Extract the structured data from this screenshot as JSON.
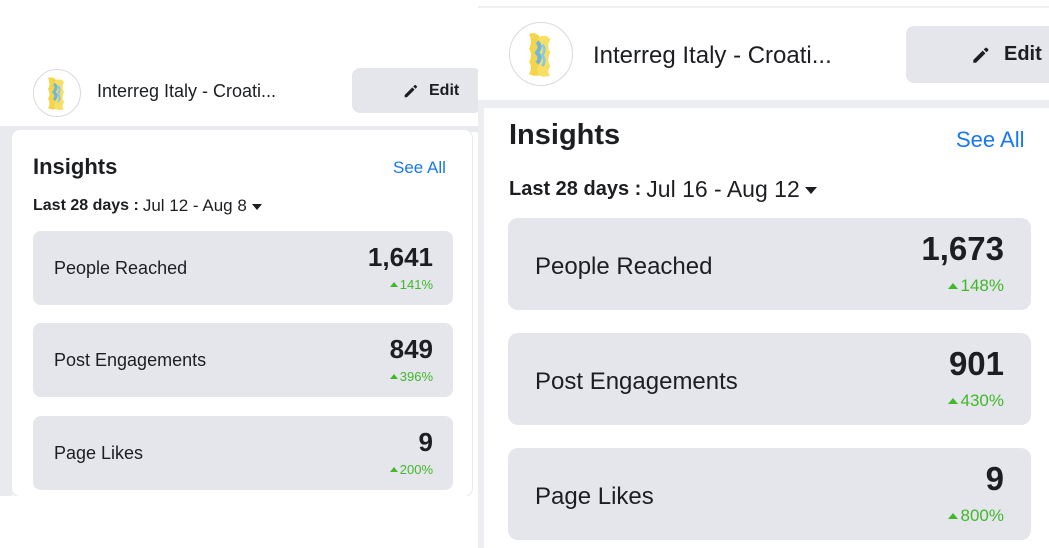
{
  "screens": [
    {
      "page_name": "Interreg Italy - Croati...",
      "edit_label": "Edit",
      "insights_title": "Insights",
      "see_all": "See All",
      "period_label": "Last 28 days :",
      "date_range": "Jul 12 - Aug 8",
      "metrics": [
        {
          "label": "People Reached",
          "value": "1,641",
          "change": "141%"
        },
        {
          "label": "Post Engagements",
          "value": "849",
          "change": "396%"
        },
        {
          "label": "Page Likes",
          "value": "9",
          "change": "200%"
        }
      ]
    },
    {
      "page_name": "Interreg Italy - Croati...",
      "edit_label": "Edit",
      "insights_title": "Insights",
      "see_all": "See All",
      "period_label": "Last 28 days :",
      "date_range": "Jul 16 - Aug 12",
      "metrics": [
        {
          "label": "People Reached",
          "value": "1,673",
          "change": "148%"
        },
        {
          "label": "Post Engagements",
          "value": "901",
          "change": "430%"
        },
        {
          "label": "Page Likes",
          "value": "9",
          "change": "800%"
        }
      ]
    }
  ],
  "colors": {
    "accent_link": "#1877f2",
    "positive_change": "#42b72a",
    "metric_card_bg": "#e4e6eb",
    "text": "#1c1e21"
  },
  "icons": {
    "edit": "pencil-icon",
    "dropdown": "caret-down-icon",
    "trend": "triangle-up-icon",
    "avatar": "interreg-logo-icon"
  }
}
